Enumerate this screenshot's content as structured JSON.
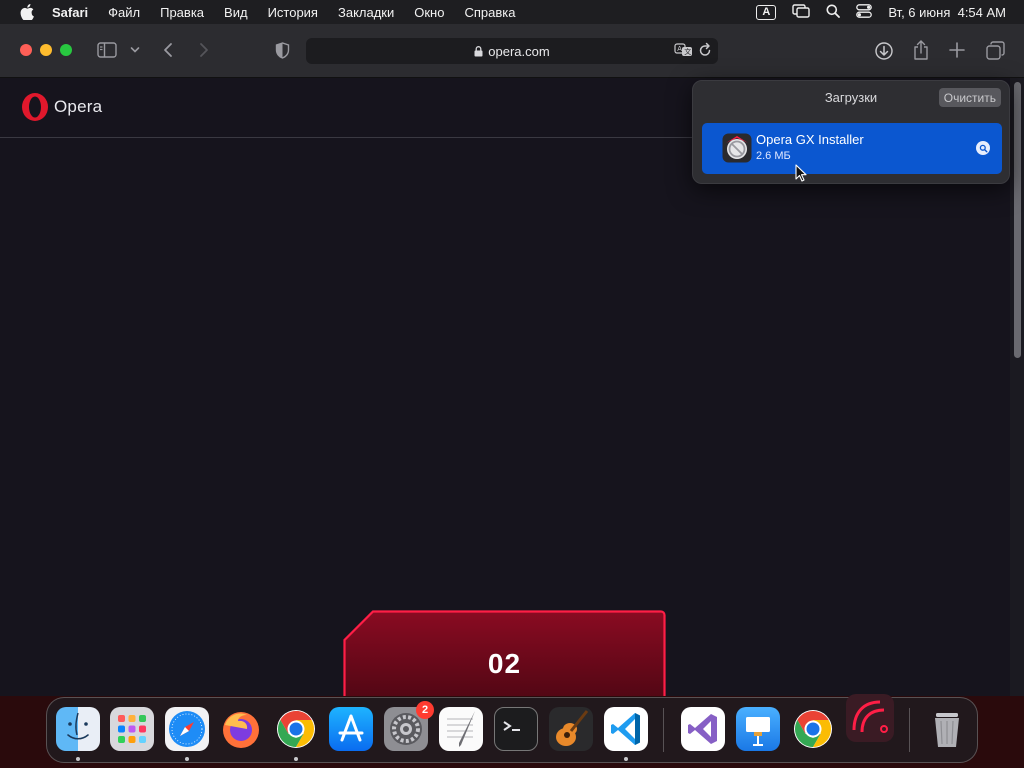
{
  "menubar": {
    "app_name": "Safari",
    "items": [
      "Файл",
      "Правка",
      "Вид",
      "История",
      "Закладки",
      "Окно",
      "Справка"
    ],
    "input_source": "A",
    "datetime": "Вт, 6 июня  4:54 AM"
  },
  "browser": {
    "url": "opera.com"
  },
  "page": {
    "logo_text": "Opera",
    "card_label": "02"
  },
  "downloads": {
    "title": "Загрузки",
    "clear_label": "Очистить",
    "items": [
      {
        "name": "Opera GX Installer",
        "size": "2.6 МБ"
      }
    ]
  },
  "dock": {
    "apps": [
      {
        "name": "finder",
        "running": true
      },
      {
        "name": "launchpad",
        "running": false
      },
      {
        "name": "safari",
        "running": true
      },
      {
        "name": "firefox",
        "running": false
      },
      {
        "name": "chrome",
        "running": true
      },
      {
        "name": "app-store",
        "running": false
      },
      {
        "name": "system-settings",
        "running": false,
        "badge": "2"
      },
      {
        "name": "textedit",
        "running": false
      },
      {
        "name": "terminal",
        "running": false
      },
      {
        "name": "garageband",
        "running": false
      },
      {
        "name": "vscode",
        "running": true
      },
      {
        "name": "visual-studio",
        "running": false
      },
      {
        "name": "keynote",
        "running": false
      },
      {
        "name": "chrome-2",
        "running": false
      },
      {
        "name": "opera-gx-installer",
        "running": false
      },
      {
        "name": "trash",
        "running": false
      }
    ]
  },
  "colors": {
    "accent_blue": "#0b57d0",
    "opera_red": "#e0182c",
    "gx_red": "#ff1e46"
  }
}
